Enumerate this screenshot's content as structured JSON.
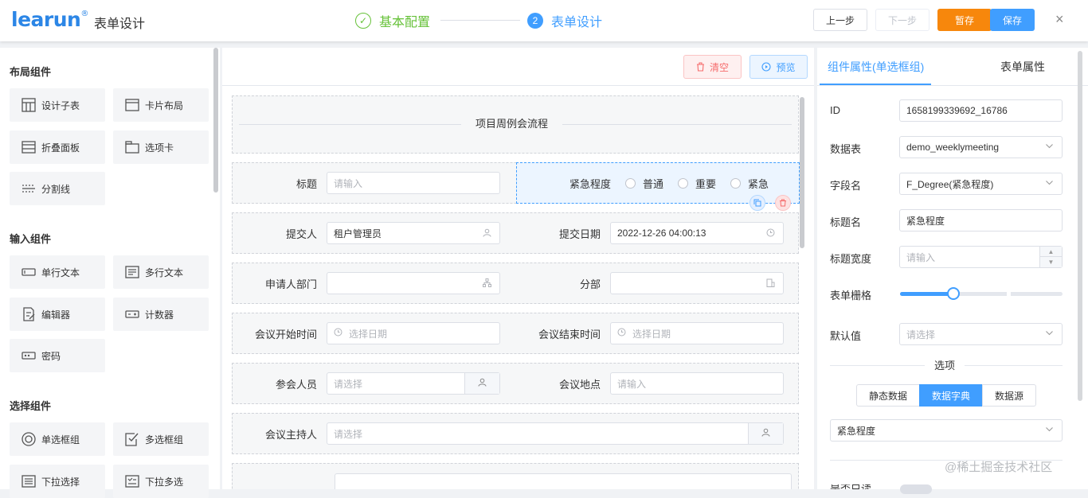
{
  "header": {
    "logo": "learun",
    "logo_mark": "®",
    "title": "表单设计",
    "steps": [
      {
        "num": "✓",
        "label": "基本配置"
      },
      {
        "num": "2",
        "label": "表单设计"
      }
    ],
    "buttons": {
      "prev": "上一步",
      "next": "下一步",
      "stash": "暂存",
      "save": "保存"
    },
    "close": "×"
  },
  "left_panel": {
    "sections": [
      {
        "title": "布局组件",
        "items": [
          "设计子表",
          "卡片布局",
          "折叠面板",
          "选项卡",
          "分割线"
        ]
      },
      {
        "title": "输入组件",
        "items": [
          "单行文本",
          "多行文本",
          "编辑器",
          "计数器",
          "密码"
        ]
      },
      {
        "title": "选择组件",
        "items": [
          "单选框组",
          "多选框组",
          "下拉选择",
          "下拉多选"
        ]
      }
    ]
  },
  "toolbar": {
    "clear": "清空",
    "preview": "预览"
  },
  "form": {
    "divider_title": "项目周例会流程",
    "fields": {
      "title": {
        "label": "标题",
        "placeholder": "请输入"
      },
      "urgency": {
        "label": "紧急程度",
        "options": [
          "普通",
          "重要",
          "紧急"
        ]
      },
      "submitter": {
        "label": "提交人",
        "value": "租户管理员"
      },
      "submit_date": {
        "label": "提交日期",
        "value": "2022-12-26 04:00:13"
      },
      "applicant_dept": {
        "label": "申请人部门",
        "value": ""
      },
      "division": {
        "label": "分部",
        "value": ""
      },
      "start_time": {
        "label": "会议开始时间",
        "placeholder": "选择日期"
      },
      "end_time": {
        "label": "会议结束时间",
        "placeholder": "选择日期"
      },
      "attendees": {
        "label": "参会人员",
        "placeholder": "请选择"
      },
      "location": {
        "label": "会议地点",
        "placeholder": "请输入"
      },
      "host": {
        "label": "会议主持人",
        "placeholder": "请选择"
      }
    }
  },
  "properties": {
    "tabs": [
      "组件属性(单选框组)",
      "表单属性"
    ],
    "rows": {
      "id": {
        "label": "ID",
        "value": "1658199339692_16786"
      },
      "table": {
        "label": "数据表",
        "value": "demo_weeklymeeting"
      },
      "field": {
        "label": "字段名",
        "value": "F_Degree(紧急程度)"
      },
      "caption": {
        "label": "标题名",
        "value": "紧急程度"
      },
      "caption_width": {
        "label": "标题宽度",
        "placeholder": "请输入"
      },
      "grid": {
        "label": "表单栅格",
        "value_fraction": 0.33
      },
      "default": {
        "label": "默认值",
        "placeholder": "请选择"
      }
    },
    "options_divider": "选项",
    "source_tabs": [
      "静态数据",
      "数据字典",
      "数据源"
    ],
    "dict_value": "紧急程度",
    "cut_label": "是否只读"
  },
  "watermark": "@稀土掘金技术社区",
  "colors": {
    "primary": "#409eff",
    "success": "#67c23a",
    "warning": "#f7870c",
    "danger": "#f56c6c",
    "logo": "#2c86e6"
  }
}
